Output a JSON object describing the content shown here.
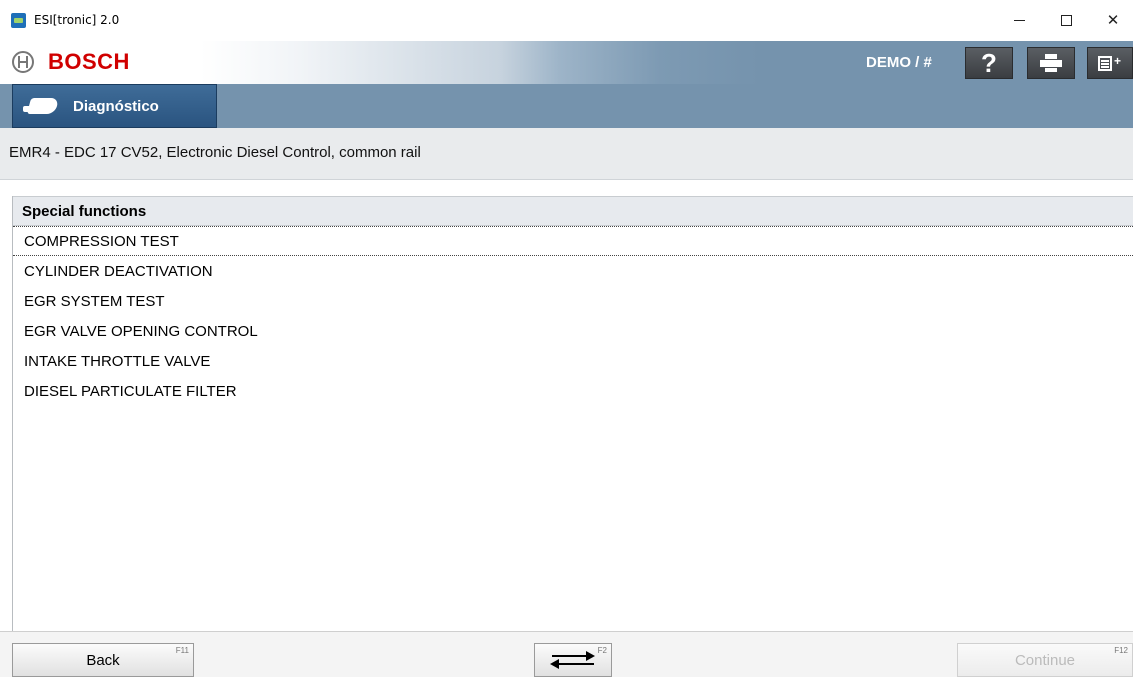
{
  "window": {
    "title": "ESI[tronic] 2.0",
    "minimize_label": "—",
    "maximize_label": "☐",
    "close_label": "✕"
  },
  "header": {
    "brand": "BOSCH",
    "user": "DEMO / #",
    "help_label": "?",
    "brand_color": "#d00000"
  },
  "tabs": {
    "diagnostics_label": "Diagnóstico"
  },
  "info": {
    "system": "EMR4 - EDC 17 CV52, Electronic Diesel Control, common rail"
  },
  "list": {
    "header": "Special functions",
    "items": [
      "COMPRESSION TEST",
      "CYLINDER DEACTIVATION",
      "EGR SYSTEM TEST",
      "EGR VALVE OPENING CONTROL",
      "INTAKE THROTTLE VALVE",
      "DIESEL PARTICULATE FILTER"
    ],
    "selected_index": 0
  },
  "footer": {
    "back_label": "Back",
    "back_key": "F11",
    "swap_key": "F2",
    "continue_label": "Continue",
    "continue_key": "F12"
  },
  "icons": {
    "app": "app-icon",
    "brand": "bosch-logo-icon",
    "help": "help-icon",
    "print": "printer-icon",
    "notes": "notes-icon",
    "diagnostics": "diagnostic-connector-icon",
    "swap": "swap-arrows-icon"
  }
}
